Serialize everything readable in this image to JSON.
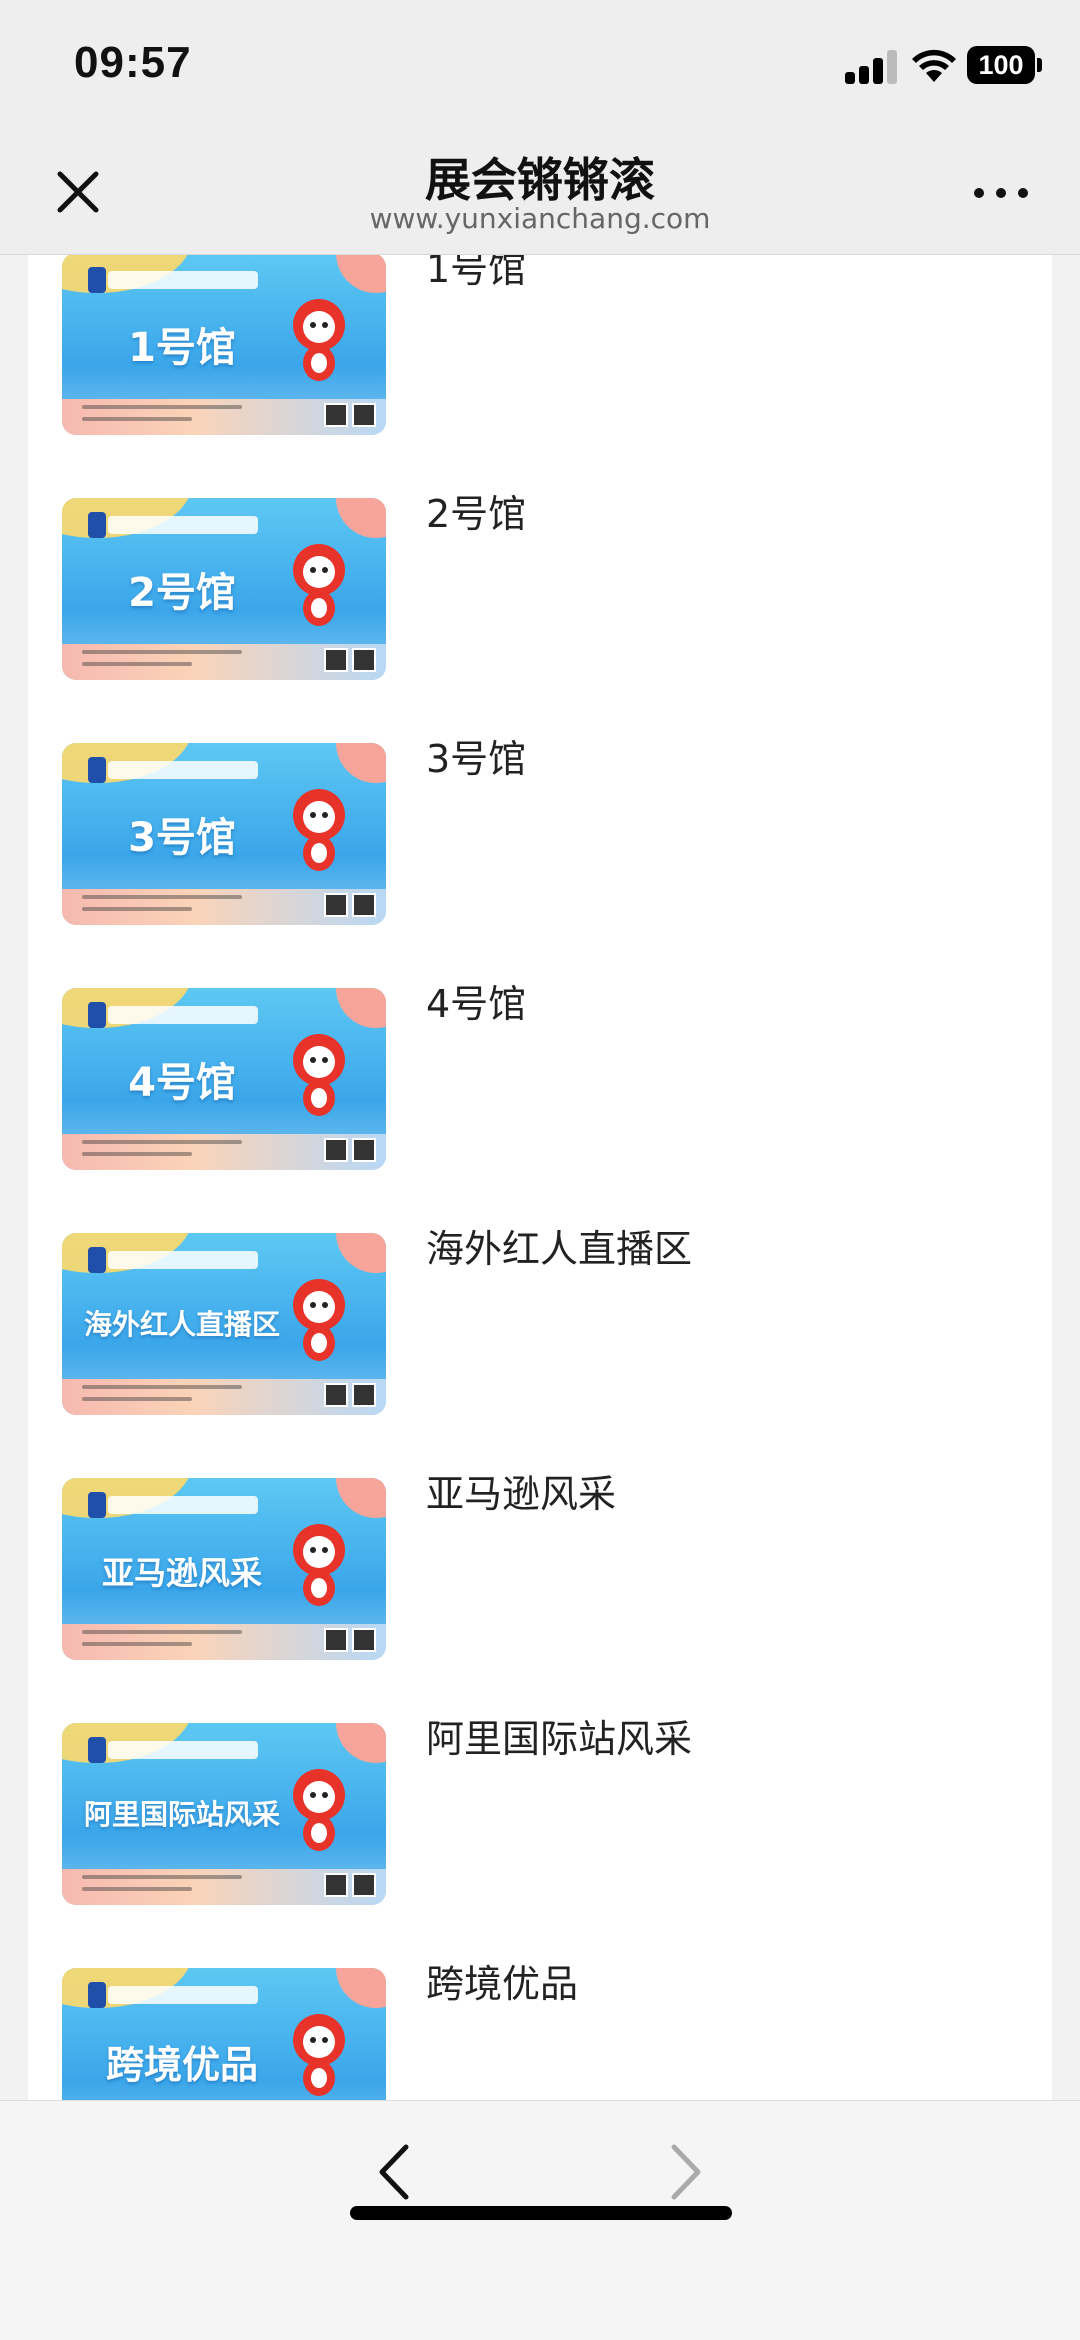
{
  "status_bar": {
    "time": "09:57",
    "battery": "100",
    "icons": [
      "cellular-signal-icon",
      "wifi-icon",
      "battery-icon"
    ]
  },
  "nav": {
    "title": "展会锵锵滚",
    "subtitle": "www.yunxianchang.com",
    "left_icon": "close-icon",
    "right_icon": "more-icon"
  },
  "list": {
    "items": [
      {
        "label": "1号馆",
        "thumb_text": "1号馆"
      },
      {
        "label": "2号馆",
        "thumb_text": "2号馆"
      },
      {
        "label": "3号馆",
        "thumb_text": "3号馆"
      },
      {
        "label": "4号馆",
        "thumb_text": "4号馆"
      },
      {
        "label": "海外红人直播区",
        "thumb_text": "海外红人直播区"
      },
      {
        "label": "亚马逊风采",
        "thumb_text": "亚马逊风采"
      },
      {
        "label": "阿里国际站风采",
        "thumb_text": "阿里国际站风采"
      },
      {
        "label": "跨境优品",
        "thumb_text": "跨境优品"
      }
    ]
  },
  "toolbar": {
    "back_icon": "chevron-left-icon",
    "forward_icon": "chevron-right-icon",
    "forward_enabled": false
  },
  "colors": {
    "banner_blue": "#3aa6ea",
    "banner_yellow": "#ffd96a",
    "mascot_red": "#e8332a",
    "disabled_gray": "#aaaaaa"
  }
}
